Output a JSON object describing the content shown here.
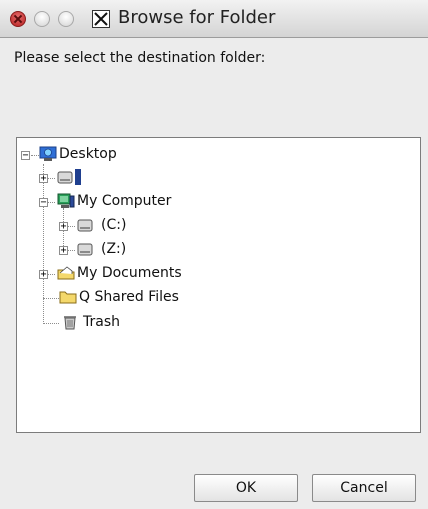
{
  "window": {
    "title": "Browse for Folder"
  },
  "prompt": "Please select the destination folder:",
  "tree": {
    "items": [
      {
        "label": "Desktop",
        "icon": "desktop-icon",
        "expander": "−"
      },
      {
        "label": "",
        "icon": "drive-icon",
        "expander": "+"
      },
      {
        "label": "My Computer",
        "icon": "computer-icon",
        "expander": "−"
      },
      {
        "label": "(C:)",
        "icon": "drive-icon",
        "expander": "+"
      },
      {
        "label": "(Z:)",
        "icon": "drive-icon",
        "expander": "+"
      },
      {
        "label": "My Documents",
        "icon": "documents-folder-icon",
        "expander": "+"
      },
      {
        "label": "Q Shared Files",
        "icon": "folder-icon",
        "expander": ""
      },
      {
        "label": "Trash",
        "icon": "trash-icon",
        "expander": ""
      }
    ]
  },
  "buttons": {
    "ok": "OK",
    "cancel": "Cancel"
  },
  "colors": {
    "background": "#ececec",
    "tree_background": "#ffffff",
    "close_light": "#d13a3a",
    "folder_yellow": "#f4d86b"
  }
}
